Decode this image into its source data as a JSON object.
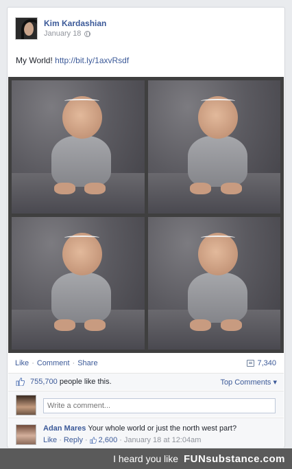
{
  "post": {
    "author": "Kim Kardashian",
    "date": "January 18",
    "privacy_icon": "globe-icon",
    "text": "My World!",
    "link": "http://bit.ly/1axvRsdf"
  },
  "actions": {
    "like": "Like",
    "comment": "Comment",
    "share": "Share",
    "sep": "·",
    "comments_count": "7,340"
  },
  "likes": {
    "count": "755,700",
    "suffix": "people like this.",
    "top_comments": "Top Comments ▾"
  },
  "comment_box": {
    "placeholder": "Write a comment..."
  },
  "comment": {
    "author": "Adan Mares",
    "text": "Your whole world or just the north west part?",
    "like": "Like",
    "reply": "Reply",
    "likes": "2,600",
    "time": "January 18 at 12:04am"
  },
  "watermark": {
    "text": "I heard you like",
    "brand": "FUNsubstance.com"
  },
  "colors": {
    "link": "#3b5998",
    "muted": "#90949c",
    "background": "#e9ebee"
  }
}
